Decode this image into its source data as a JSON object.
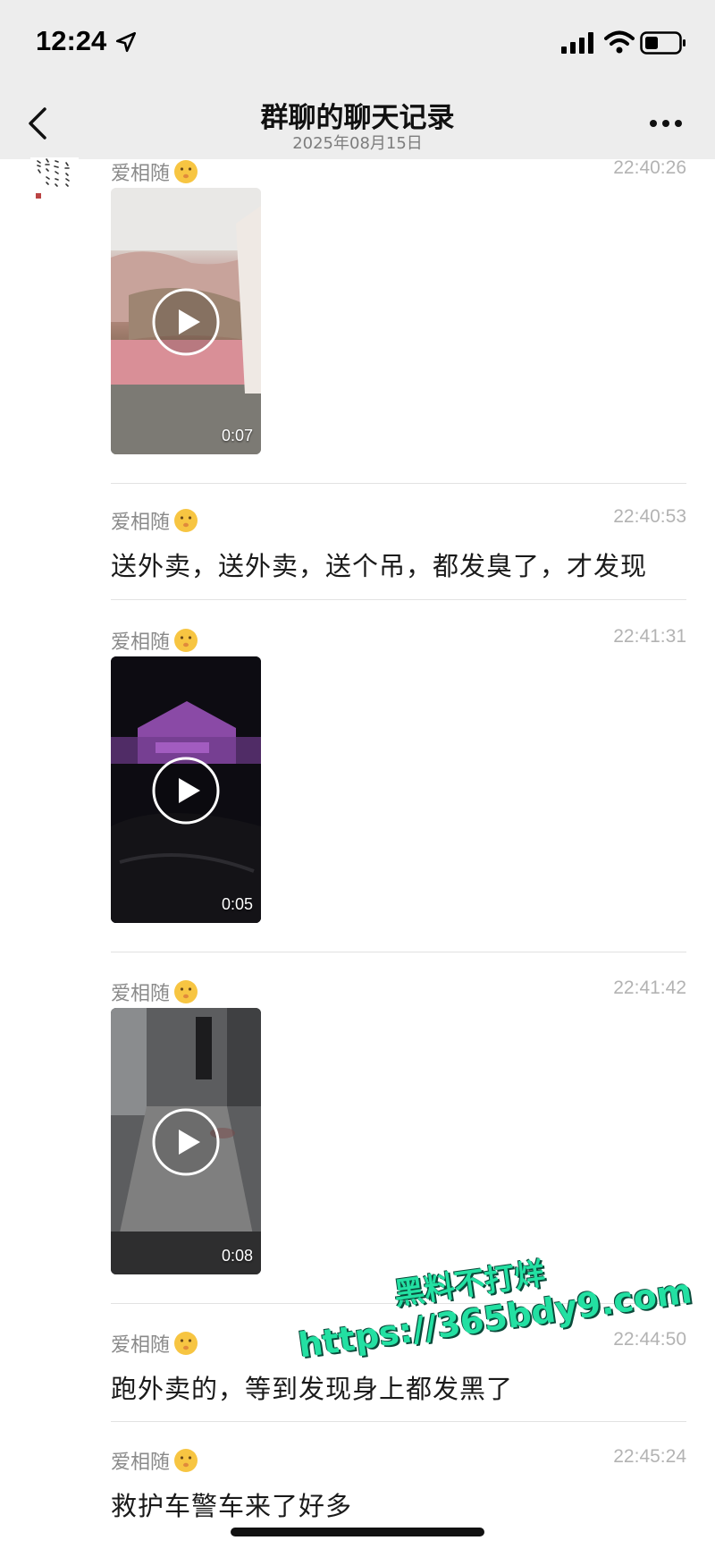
{
  "status_bar": {
    "time": "12:24",
    "icons": [
      "location-arrow-icon",
      "signal-icon",
      "wifi-icon",
      "battery-icon"
    ]
  },
  "nav": {
    "title": "群聊的聊天记录",
    "date": "2025年08月15日",
    "back_icon": "chevron-left-icon",
    "more_icon": "more-dots-icon"
  },
  "messages": [
    {
      "sender": "爱相随",
      "time": "22:40:26",
      "type": "video",
      "duration": "0:07"
    },
    {
      "sender": "爱相随",
      "time": "22:40:53",
      "type": "text",
      "text": "送外卖，送外卖，送个吊，都发臭了，才发现"
    },
    {
      "sender": "爱相随",
      "time": "22:41:31",
      "type": "video",
      "duration": "0:05"
    },
    {
      "sender": "爱相随",
      "time": "22:41:42",
      "type": "video",
      "duration": "0:08"
    },
    {
      "sender": "爱相随",
      "time": "22:44:50",
      "type": "text",
      "text": "跑外卖的，等到发现身上都发黑了"
    },
    {
      "sender": "爱相随",
      "time": "22:45:24",
      "type": "text",
      "text": "救护车警车来了好多"
    }
  ],
  "watermark": {
    "line1": "黑料不打烊",
    "line2": "https://365bdy9.com"
  },
  "colors": {
    "header_bg": "#ededed",
    "watermark": "#23e0a2"
  }
}
